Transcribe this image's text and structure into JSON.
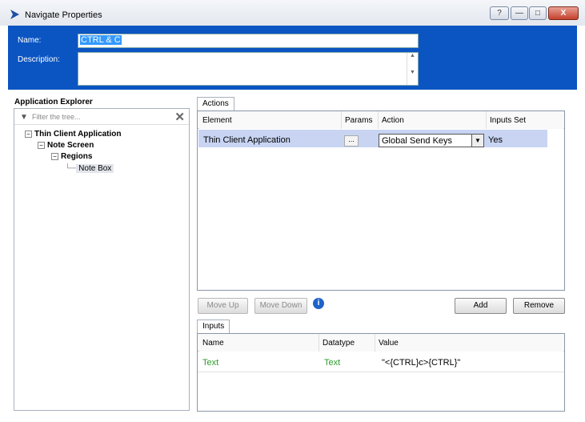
{
  "window": {
    "title": "Navigate Properties",
    "help_btn": "?",
    "min_btn": "—",
    "max_btn": "□",
    "close_btn": "X"
  },
  "header": {
    "name_label": "Name:",
    "name_value": "CTRL & C",
    "description_label": "Description:",
    "description_value": ""
  },
  "explorer": {
    "title": "Application Explorer",
    "filter_placeholder": "Filter the tree...",
    "tree": [
      {
        "label": "Thin Client Application",
        "toggle": "−"
      },
      {
        "label": "Note Screen",
        "toggle": "−"
      },
      {
        "label": "Regions",
        "toggle": "−"
      },
      {
        "label": "Note Box"
      }
    ]
  },
  "actions": {
    "tab_label": "Actions",
    "columns": [
      "Element",
      "Params",
      "Action",
      "Inputs Set"
    ],
    "rows": [
      {
        "element": "Thin Client Application",
        "params": "...",
        "action": "Global Send Keys",
        "inputs_set": "Yes"
      }
    ],
    "buttons": {
      "move_up": "Move Up",
      "move_down": "Move Down",
      "add": "Add",
      "remove": "Remove"
    }
  },
  "inputs": {
    "tab_label": "Inputs",
    "columns": [
      "Name",
      "Datatype",
      "Value"
    ],
    "rows": [
      {
        "name": "Text",
        "datatype": "Text",
        "value": "\"<{CTRL}c>{CTRL}\""
      }
    ]
  },
  "colors": {
    "header_blue": "#0b55c2",
    "selection_blue": "#c8d4f2",
    "input_green": "#2e9b2e"
  },
  "icons": [
    "app-icon",
    "filter-icon",
    "clear-filter-icon",
    "info-icon",
    "dropdown-arrow-icon"
  ]
}
